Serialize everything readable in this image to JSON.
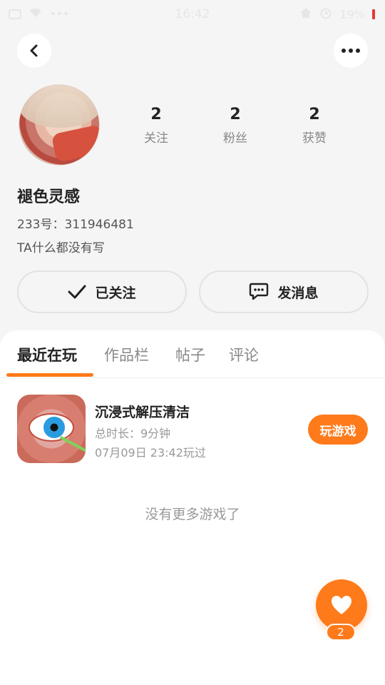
{
  "status_bar": {
    "time": "16:42",
    "battery_percent": "19%"
  },
  "profile": {
    "username": "褪色灵感",
    "id_label": "233号：",
    "id_value": "311946481",
    "bio": "TA什么都没有写",
    "stats": [
      {
        "num": "2",
        "label": "关注"
      },
      {
        "num": "2",
        "label": "粉丝"
      },
      {
        "num": "2",
        "label": "获赞"
      }
    ],
    "follow_label": "已关注",
    "message_label": "发消息"
  },
  "tabs": [
    {
      "label": "最近在玩",
      "active": true
    },
    {
      "label": "作品栏",
      "active": false
    },
    {
      "label": "帖子",
      "active": false
    },
    {
      "label": "评论",
      "active": false
    }
  ],
  "games": [
    {
      "title": "沉浸式解压清洁",
      "duration": "总时长：9分钟",
      "last_played": "07月09日 23:42玩过",
      "play_label": "玩游戏"
    }
  ],
  "empty_text": "没有更多游戏了",
  "like": {
    "count": "2"
  },
  "colors": {
    "accent": "#ff7a1a",
    "background": "#f5f5f5"
  }
}
